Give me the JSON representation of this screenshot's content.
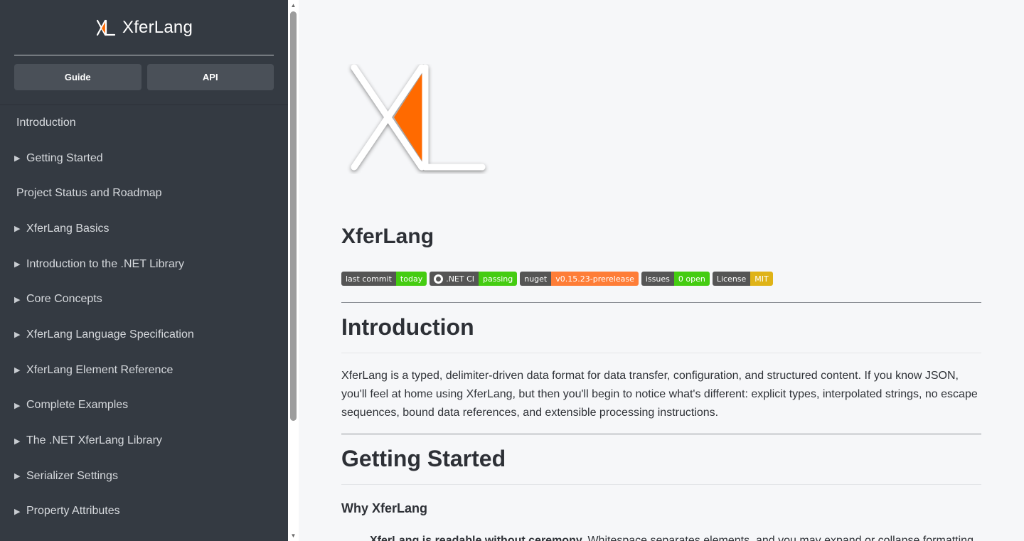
{
  "sidebar": {
    "brand_title": "XferLang",
    "buttons": {
      "guide": "Guide",
      "api": "API"
    },
    "items": [
      {
        "label": "Introduction",
        "has_caret": false
      },
      {
        "label": "Getting Started",
        "has_caret": true
      },
      {
        "label": "Project Status and Roadmap",
        "has_caret": false
      },
      {
        "label": "XferLang Basics",
        "has_caret": true
      },
      {
        "label": "Introduction to the .NET Library",
        "has_caret": true
      },
      {
        "label": "Core Concepts",
        "has_caret": true
      },
      {
        "label": "XferLang Language Specification",
        "has_caret": true
      },
      {
        "label": "XferLang Element Reference",
        "has_caret": true
      },
      {
        "label": "Complete Examples",
        "has_caret": true
      },
      {
        "label": "The .NET XferLang Library",
        "has_caret": true
      },
      {
        "label": "Serializer Settings",
        "has_caret": true
      },
      {
        "label": "Property Attributes",
        "has_caret": true
      }
    ],
    "caret_glyph": "▶"
  },
  "main": {
    "title": "XferLang",
    "badges": [
      {
        "label": "last commit",
        "value": "today",
        "color": "#4c1"
      },
      {
        "label": ".NET CI",
        "value": "passing",
        "color": "#4c1",
        "icon": "github-icon"
      },
      {
        "label": "nuget",
        "value": "v0.15.23-prerelease",
        "color": "#fe7d37"
      },
      {
        "label": "issues",
        "value": "0 open",
        "color": "#4c1"
      },
      {
        "label": "License",
        "value": "MIT",
        "color": "#dfb317"
      }
    ],
    "intro_heading": "Introduction",
    "intro_text": "XferLang is a typed, delimiter-driven data format for data transfer, configuration, and structured content. If you know JSON, you'll feel at home using XferLang, but then you'll begin to notice what's different: explicit types, interpolated strings, no escape sequences, bound data references, and extensible processing instructions.",
    "getting_started_heading": "Getting Started",
    "why_heading": "Why XferLang",
    "partial_bold": "XferLang is readable without ceremony.",
    "partial_text": " Whitespace separates elements, and you may expand or collapse formatting"
  },
  "colors": {
    "accent": "#ff6a00",
    "sidebar_bg": "#343a42"
  }
}
